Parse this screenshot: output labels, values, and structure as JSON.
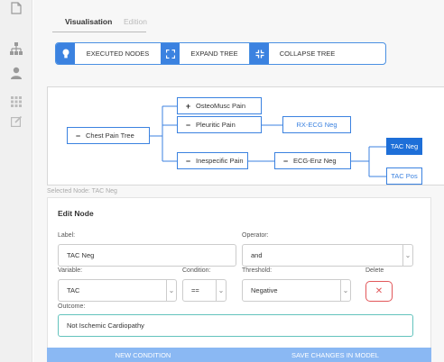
{
  "tabs": [
    {
      "label": "Visualisation"
    },
    {
      "label": "Edition"
    }
  ],
  "toolbar": {
    "executed_nodes": "EXECUTED NODES",
    "expand_tree": "EXPAND TREE",
    "collapse_tree": "COLLAPSE TREE"
  },
  "tree": {
    "root": {
      "symbol": "−",
      "label": "Chest Pain Tree"
    },
    "osteo": {
      "symbol": "+",
      "label": "OsteoMusc Pain"
    },
    "pleuritic": {
      "symbol": "−",
      "label": "Pleuritic Pain"
    },
    "rx_ecg": {
      "label": "RX-ECG Neg"
    },
    "inespecific": {
      "symbol": "−",
      "label": "Inespecific Pain"
    },
    "ecg_enz": {
      "symbol": "−",
      "label": "ECG-Enz Neg"
    },
    "tac_neg": {
      "label": "TAC Neg"
    },
    "tac_pos": {
      "label": "TAC Pos"
    }
  },
  "selected_node_text": "Selected Node: TAC Neg",
  "edit": {
    "title": "Edit Node",
    "label_caption": "Label:",
    "label_value": "TAC Neg",
    "operator_caption": "Operator:",
    "operator_value": "and",
    "variable_caption": "Variable:",
    "variable_value": "TAC",
    "condition_caption": "Condition:",
    "condition_value": "==",
    "threshold_caption": "Threshold:",
    "threshold_value": "Negative",
    "delete_caption": "Delete",
    "delete_symbol": "✕",
    "outcome_caption": "Outcome:",
    "outcome_value": "Not Ischemic Cardiopathy"
  },
  "bottom": {
    "new_condition": "NEW CONDITION",
    "save_changes": "SAVE CHANGES IN MODEL"
  },
  "colors": {
    "accent": "#3b82e0",
    "selected_node": "#1e6fd8",
    "delete": "#e2575a",
    "outcome_border": "#63c3bd",
    "bottom_bar": "#8ab8f3"
  }
}
